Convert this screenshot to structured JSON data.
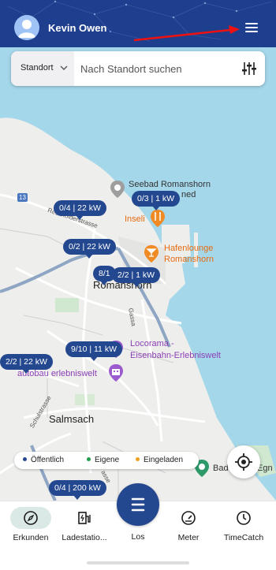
{
  "header": {
    "user_name": "Kevin Owen",
    "background": "#1d3f8d"
  },
  "search": {
    "scope_label": "Standort",
    "placeholder": "Nach Standort suchen"
  },
  "map": {
    "pills": [
      {
        "label": "0/3 | 1 kW"
      },
      {
        "label": "0/4 | 22 kW"
      },
      {
        "label": "0/2 | 22 kW"
      },
      {
        "label": "8/1"
      },
      {
        "label": "2/2 | 1 kW"
      },
      {
        "label": "9/10 | 11 kW"
      },
      {
        "label": "2/2 | 22 kW"
      },
      {
        "label": "0/4 | 200 kW"
      }
    ],
    "pois": {
      "seebad": "Seebad Romanshorn",
      "seebad_partial": "ned",
      "inseli": "Inseli",
      "hafenlounge_1": "Hafenlounge",
      "hafenlounge_2": "Romanshorn",
      "locorama_1": "Locorama -",
      "locorama_2": "Eisenbahn-Erlebniswelt",
      "autobau": "autobau erlebniswelt",
      "bad_partial": "Bad",
      "egn_partial": "Egn"
    },
    "towns": {
      "romanshorn": "Romanshorn",
      "salmsach": "Salmsach"
    },
    "streets": {
      "road_13": "13",
      "reckholderstrasse": "Reckholderstrasse",
      "gassa": "Gassa",
      "schulstrasse": "Schulstrasse",
      "strasse_bottom": "asse"
    }
  },
  "legend": {
    "items": [
      {
        "label": "Öffentlich",
        "color": "#24488f"
      },
      {
        "label": "Eigene",
        "color": "#1e9e4a"
      },
      {
        "label": "Eingeladen",
        "color": "#f0a020"
      }
    ]
  },
  "bottom_nav": {
    "items": [
      {
        "label": "Erkunden",
        "icon": "compass-icon",
        "active": true
      },
      {
        "label": "Ladestatio...",
        "icon": "charging-station-icon",
        "active": false
      },
      {
        "label": "Los",
        "icon": "start-icon",
        "active": false
      },
      {
        "label": "Meter",
        "icon": "gauge-icon",
        "active": false
      },
      {
        "label": "TimeCatch",
        "icon": "clock-icon",
        "active": false
      }
    ]
  }
}
